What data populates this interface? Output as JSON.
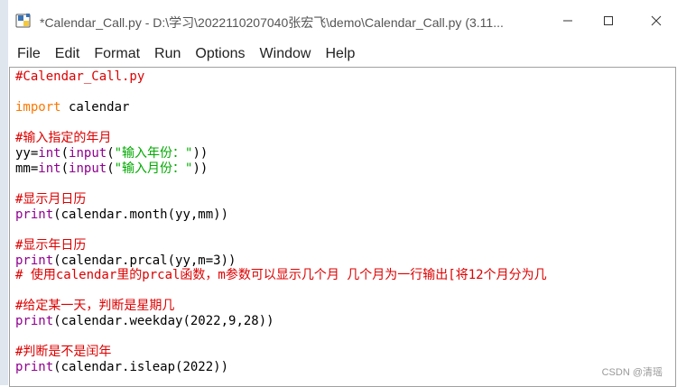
{
  "window": {
    "title": "*Calendar_Call.py - D:\\学习\\2022110207040张宏飞\\demo\\Calendar_Call.py (3.11...",
    "controls": {
      "minimize": "minimize-icon",
      "maximize": "maximize-icon",
      "close": "close-icon"
    }
  },
  "menu": [
    "File",
    "Edit",
    "Format",
    "Run",
    "Options",
    "Window",
    "Help"
  ],
  "code": {
    "l1": "#Calendar_Call.py",
    "l3_kw": "import",
    "l3_rest": " calendar",
    "l5": "#输入指定的年月",
    "l6_a": "yy=",
    "l6_int": "int",
    "l6_b": "(",
    "l6_input": "input",
    "l6_c": "(",
    "l6_str": "\"输入年份：\"",
    "l6_d": "))",
    "l7_a": "mm=",
    "l7_int": "int",
    "l7_b": "(",
    "l7_input": "input",
    "l7_c": "(",
    "l7_str": "\"输入月份：\"",
    "l7_d": "))",
    "l9": "#显示月日历",
    "l10_print": "print",
    "l10_rest": "(calendar.month(yy,mm))",
    "l12": "#显示年日历",
    "l13_print": "print",
    "l13_rest": "(calendar.prcal(yy,m=3))",
    "l14": "# 使用calendar里的prcal函数，m参数可以显示几个月 几个月为一行输出[将12个月分为几",
    "l16": "#给定某一天，判断是星期几",
    "l17_print": "print",
    "l17_rest": "(calendar.weekday(2022,9,28))",
    "l19": "#判断是不是闰年",
    "l20_print": "print",
    "l20_rest": "(calendar.isleap(2022))"
  },
  "watermark": "CSDN @清瑶",
  "colors": {
    "comment": "#dd0000",
    "keyword": "#ff7700",
    "builtin": "#900090",
    "string": "#00aa00"
  }
}
